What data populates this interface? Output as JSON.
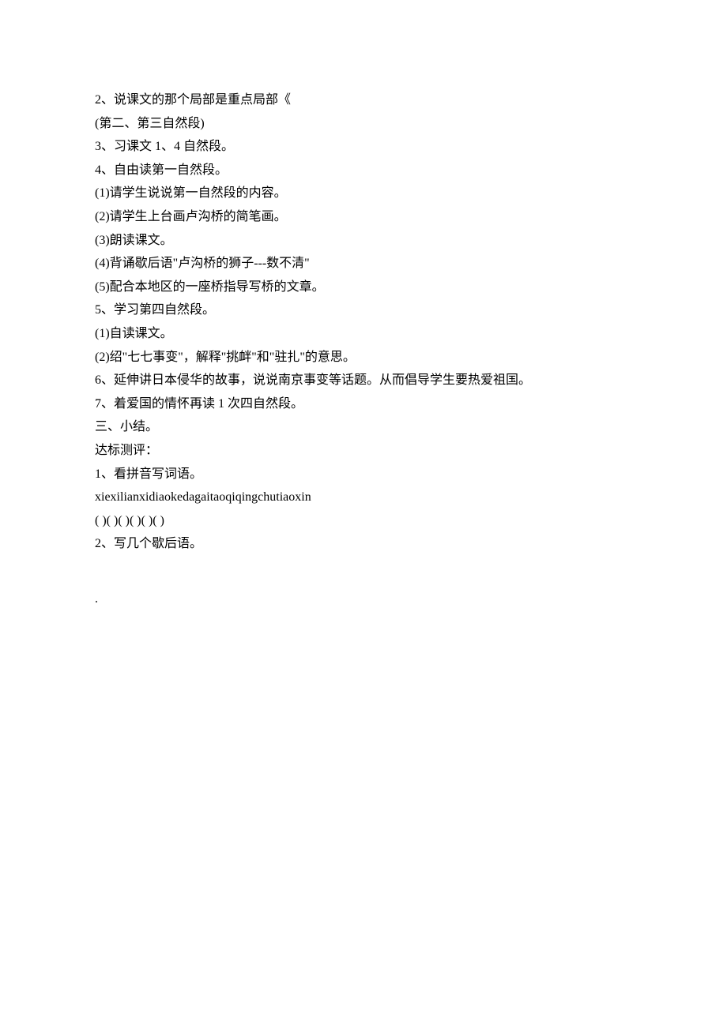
{
  "lines": {
    "l1": "2、说课文的那个局部是重点局部《",
    "l2": "(第二、第三自然段)",
    "l3": "3、习课文 1、4 自然段。",
    "l4": "4、自由读第一自然段。",
    "l5": "(1)请学生说说第一自然段的内容。",
    "l6": "(2)请学生上台画卢沟桥的简笔画。",
    "l7": "(3)朗读课文。",
    "l8": "(4)背诵歇后语\"卢沟桥的狮子---数不清\"",
    "l9": "(5)配合本地区的一座桥指导写桥的文章。",
    "l10": "5、学习第四自然段。",
    "l11": "(1)自读课文。",
    "l12": "(2)绍\"七七事变\"，解释\"挑衅\"和\"驻扎\"的意思。",
    "l13": "6、延伸讲日本侵华的故事，说说南京事变等话题。从而倡导学生要热爱祖国。",
    "l14": "7、着爱国的情怀再读 1 次四自然段。",
    "l15": "三、小结。",
    "l16": "达标测评：",
    "l17": "1、看拼音写词语。",
    "l18": "xiexilianxidiaokedagaitaoqiqingchutiaoxin",
    "l19": "( )( )( )( )( )( )",
    "l20": "2、写几个歇后语。",
    "dot": "."
  }
}
